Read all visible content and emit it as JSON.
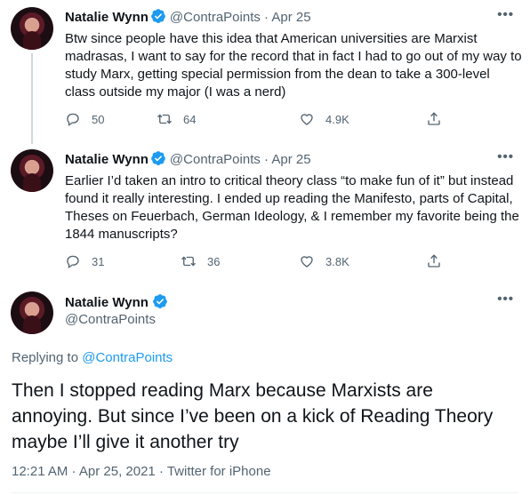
{
  "tweets": [
    {
      "name": "Natalie Wynn",
      "handle": "@ContraPoints",
      "separator": "·",
      "date": "Apr 25",
      "text": "Btw since people have this idea that American universities are Marxist madrasas, I want to say for the record that in fact I had to go out of my way to study Marx, getting special permission from the dean to take a 300-level class outside my major (I was a nerd)",
      "replies": "50",
      "retweets": "64",
      "likes": "4.9K"
    },
    {
      "name": "Natalie Wynn",
      "handle": "@ContraPoints",
      "separator": "·",
      "date": "Apr 25",
      "text": "Earlier I’d taken an intro to critical theory class “to make fun of it” but instead found it really interesting. I ended up reading the Manifesto, parts of Capital, Theses on Feuerbach, German Ideology, & I remember my favorite being the 1844 manuscripts?",
      "replies": "31",
      "retweets": "36",
      "likes": "3.8K"
    }
  ],
  "focus": {
    "name": "Natalie Wynn",
    "handle": "@ContraPoints",
    "replying_prefix": "Replying to",
    "replying_handle": "@ContraPoints",
    "text": "Then I stopped reading Marx because Marxists are annoying. But since I’ve been on a kick of Reading Theory maybe I’ll give it another try",
    "meta": "12:21 AM · Apr 25, 2021 · Twitter for iPhone"
  },
  "more_icon": "•••",
  "colors": {
    "accent": "#1d9bf0",
    "muted": "#536471",
    "text": "#0f1419",
    "thread_line": "#cfd9de"
  },
  "icons": [
    "verified-badge-icon",
    "reply-icon",
    "retweet-icon",
    "like-icon",
    "share-icon",
    "more-icon"
  ]
}
